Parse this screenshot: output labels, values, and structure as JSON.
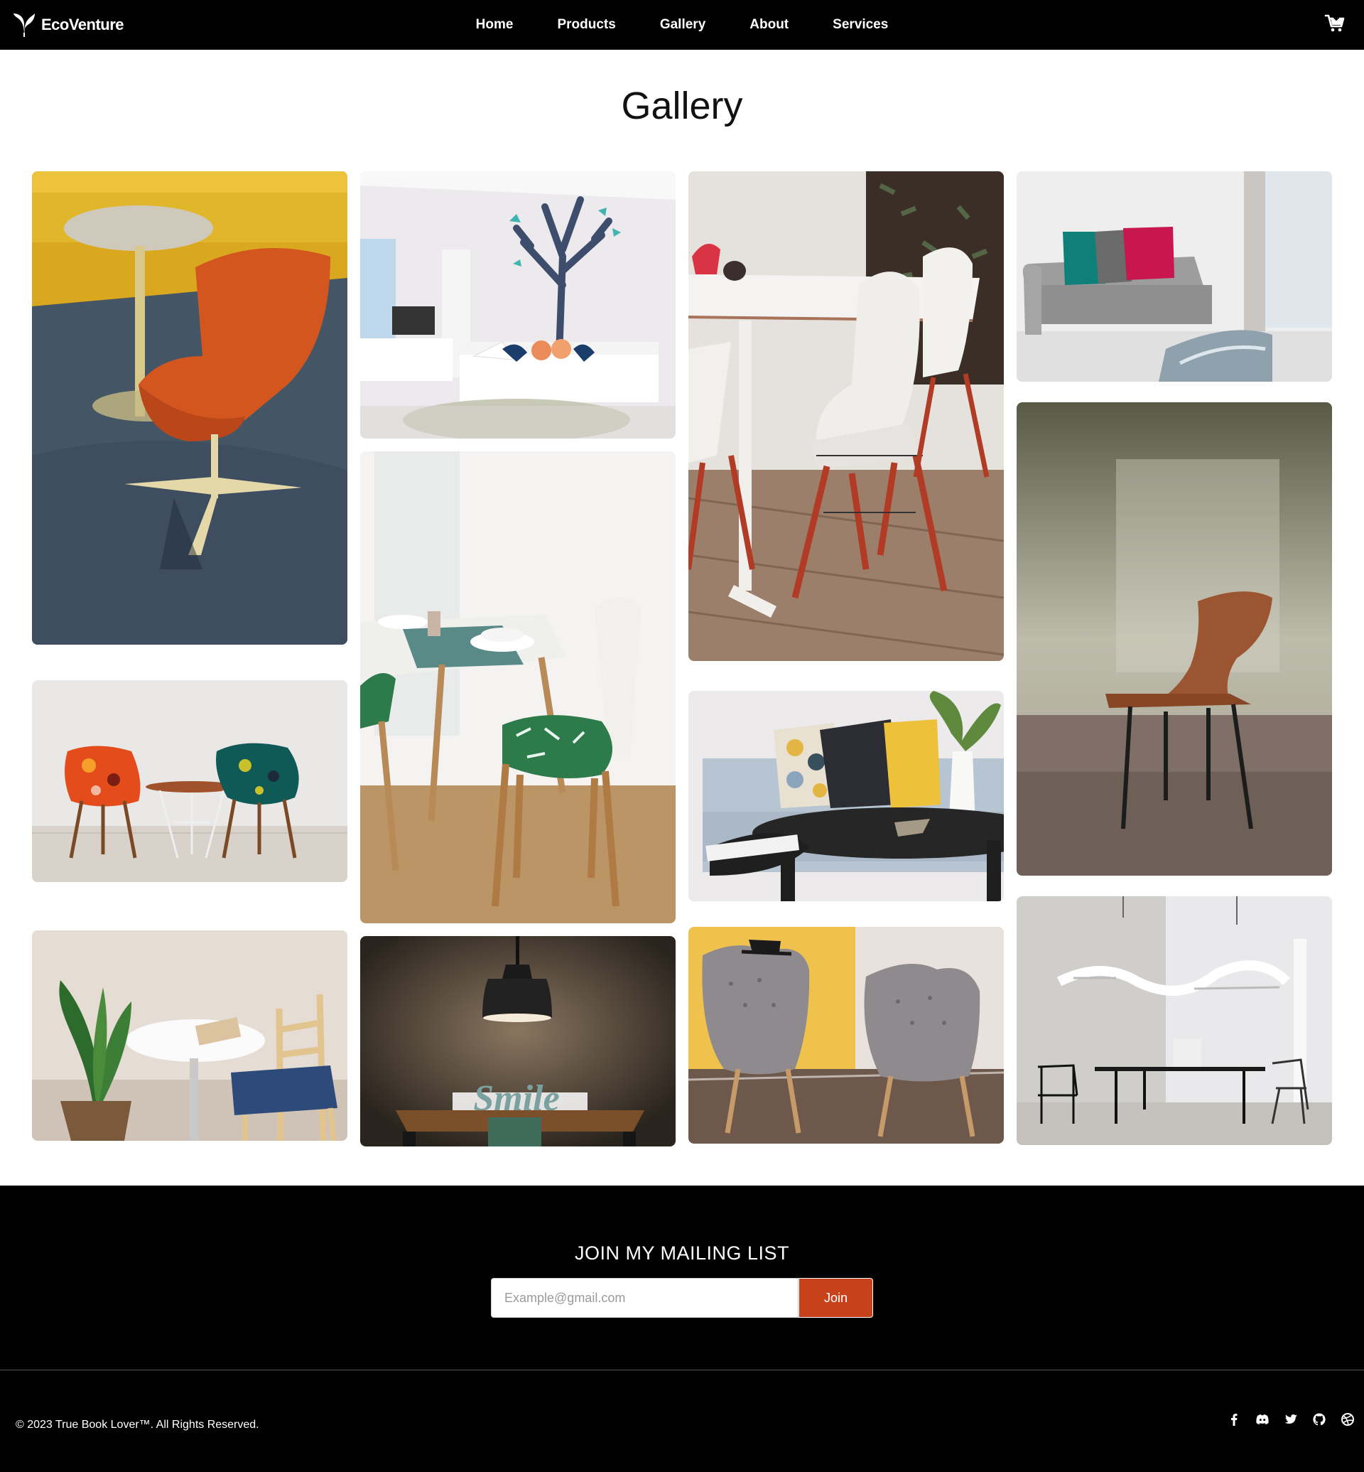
{
  "navbar": {
    "brand": "EcoVenture",
    "links": [
      "Home",
      "Products",
      "Gallery",
      "About",
      "Services"
    ]
  },
  "page": {
    "title": "Gallery"
  },
  "gallery": {
    "images": [
      "orange-chair-yellow-sofa-icon",
      "kids-room-tree-wall-icon",
      "white-dining-chairs-icon",
      "grey-sofa-pillows-icon",
      "patterned-armchairs-icon",
      "dining-table-plant-cushion-icon",
      "blue-sofa-pillows-icon",
      "wooden-bentwood-chair-icon",
      "round-table-chair-plant-icon",
      "smile-table-lamp-icon",
      "grey-armchairs-yellow-wall-icon",
      "minimal-table-pendant-lights-icon"
    ]
  },
  "footer": {
    "mailing_title": "JOIN MY MAILING LIST",
    "email_placeholder": "Example@gmail.com",
    "join_label": "Join",
    "copyright": "© 2023 True Book Lover™. All Rights Reserved.",
    "social_icons": [
      "facebook-icon",
      "discord-icon",
      "twitter-icon",
      "github-icon",
      "dribbble-icon"
    ]
  },
  "colors": {
    "navbar_bg": "#000000",
    "join_button": "#c7411b",
    "footer_bg": "#000000"
  }
}
